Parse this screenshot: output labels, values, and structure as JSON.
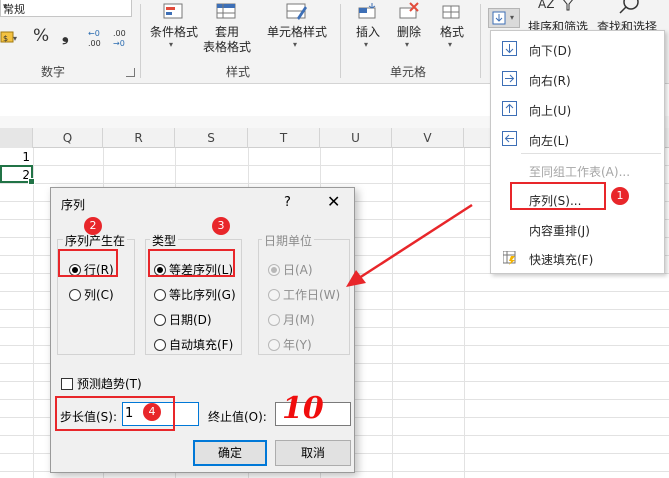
{
  "ribbon": {
    "number_format_value": "常规",
    "number_tools": {
      "accounting": "🖫",
      "percent": "%",
      "comma": "❟",
      "increase_decimal": "←.0 .00",
      "decrease_decimal": ".00 →.0"
    },
    "number_group_label": "数字",
    "styles": {
      "conditional_format": "条件格式",
      "format_as_table": "套用",
      "format_as_table_line2": "表格格式",
      "cell_styles": "单元格样式",
      "group_label": "样式"
    },
    "cells": {
      "insert": "插入",
      "delete": "删除",
      "format": "格式",
      "group_label": "单元格"
    },
    "editing": {
      "sort_filter": "排序和筛选",
      "find_select": "查找和选择"
    }
  },
  "sheet": {
    "columns": [
      "Q",
      "R",
      "S",
      "T",
      "U",
      "V"
    ],
    "cells": [
      {
        "row": 1,
        "value": "1"
      },
      {
        "row": 2,
        "value": "2"
      }
    ]
  },
  "fill_menu": {
    "items": [
      {
        "label": "向下(D)",
        "icon": "fill-down-icon",
        "enabled": true
      },
      {
        "label": "向右(R)",
        "icon": "fill-right-icon",
        "enabled": true
      },
      {
        "label": "向上(U)",
        "icon": "fill-up-icon",
        "enabled": true
      },
      {
        "label": "向左(L)",
        "icon": "fill-left-icon",
        "enabled": true
      },
      {
        "label": "至同组工作表(A)...",
        "icon": "",
        "enabled": false
      },
      {
        "label": "序列(S)...",
        "icon": "",
        "enabled": true
      },
      {
        "label": "内容重排(J)",
        "icon": "",
        "enabled": true
      },
      {
        "label": "快速填充(F)",
        "icon": "flash-fill-icon",
        "enabled": true
      }
    ]
  },
  "dialog": {
    "title": "序列",
    "help": "?",
    "close": "✕",
    "series_in": {
      "legend": "序列产生在",
      "options": [
        "行(R)",
        "列(C)"
      ],
      "selected": "行(R)"
    },
    "type": {
      "legend": "类型",
      "options": [
        "等差序列(L)",
        "等比序列(G)",
        "日期(D)",
        "自动填充(F)"
      ],
      "selected": "等差序列(L)"
    },
    "date_unit": {
      "legend": "日期单位",
      "options": [
        "日(A)",
        "工作日(W)",
        "月(M)",
        "年(Y)"
      ],
      "selected": "日(A)",
      "enabled": false
    },
    "trend_label": "预测趋势(T)",
    "step_label": "步长值(S):",
    "step_value": "1",
    "stop_label": "终止值(O):",
    "stop_value": "",
    "ok": "确定",
    "cancel": "取消"
  },
  "annotations": {
    "badges": [
      "1",
      "2",
      "3",
      "4"
    ],
    "handwritten_stop": "10"
  },
  "colors": {
    "annotation_red": "#e8262a",
    "selection_green": "#217346",
    "accent_blue": "#0078d7"
  }
}
